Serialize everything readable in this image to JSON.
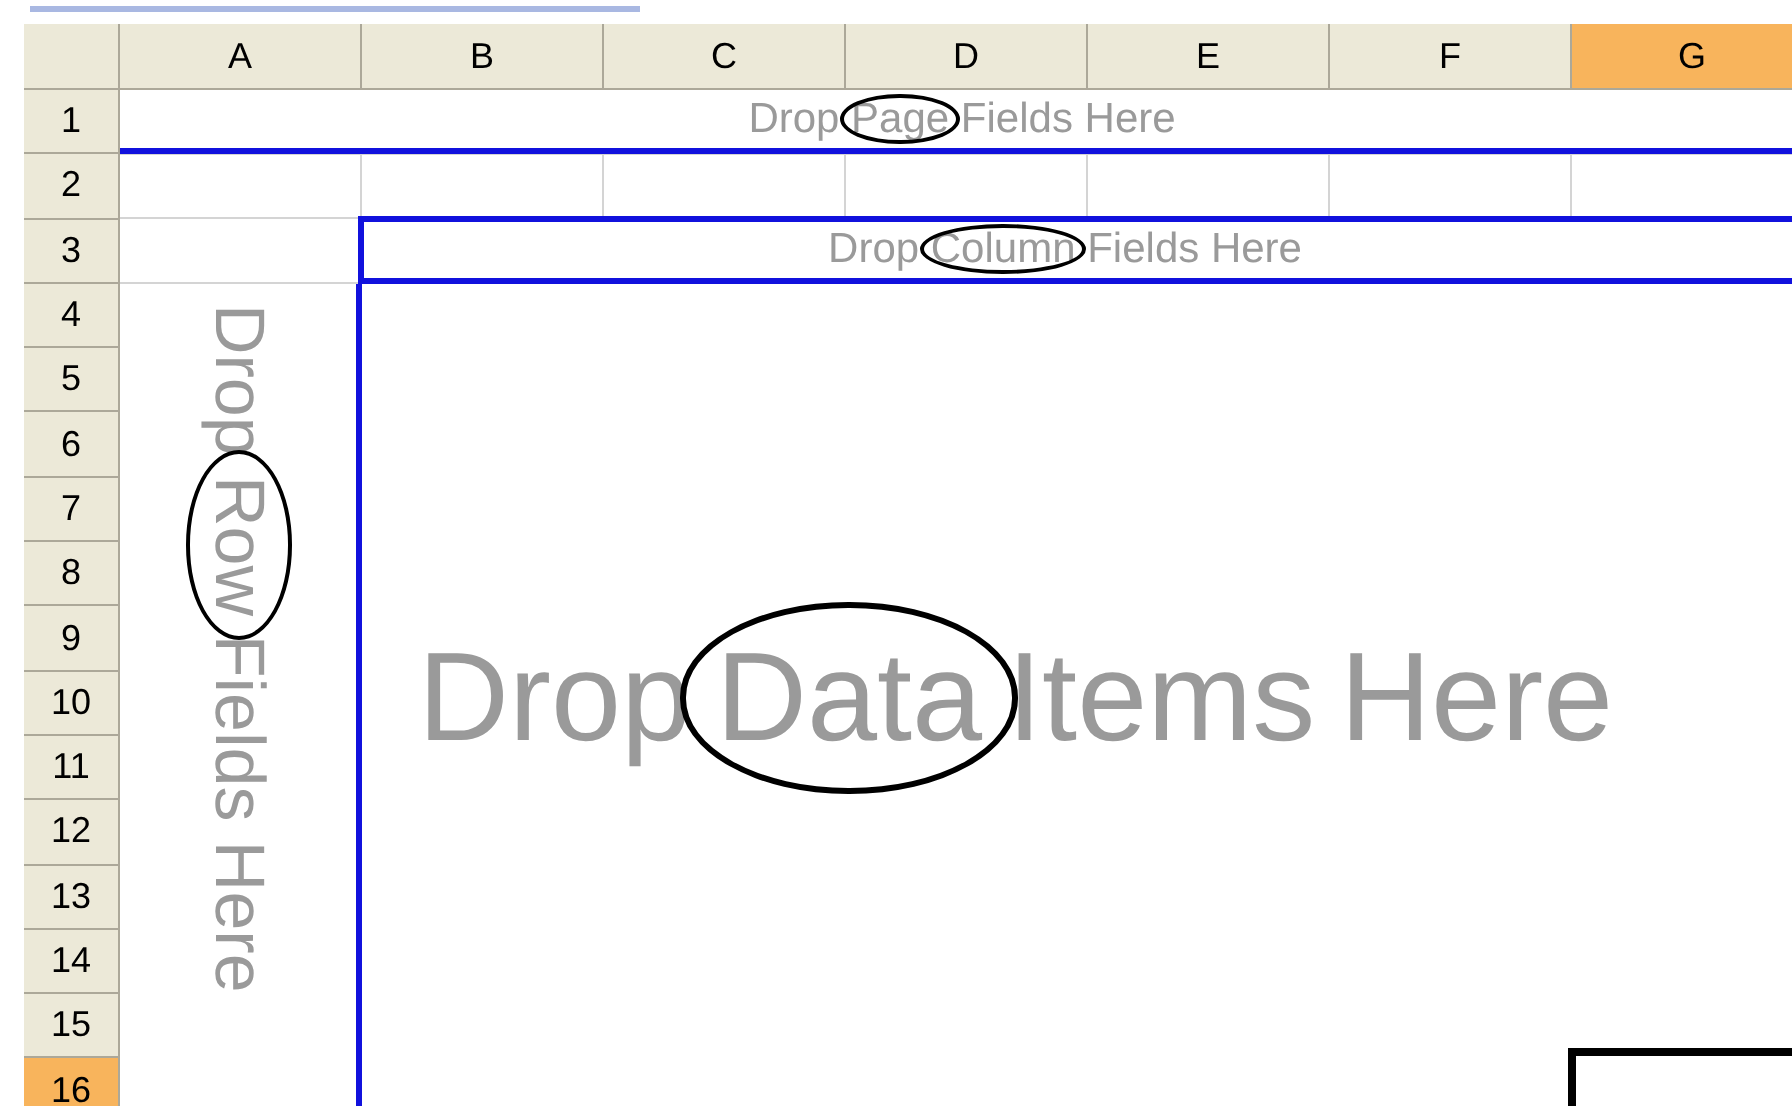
{
  "column_headers": [
    {
      "label": "A",
      "selected": false
    },
    {
      "label": "B",
      "selected": false
    },
    {
      "label": "C",
      "selected": false
    },
    {
      "label": "D",
      "selected": false
    },
    {
      "label": "E",
      "selected": false
    },
    {
      "label": "F",
      "selected": false
    },
    {
      "label": "G",
      "selected": true
    }
  ],
  "row_headers": [
    {
      "label": "1",
      "selected": false
    },
    {
      "label": "2",
      "selected": false
    },
    {
      "label": "3",
      "selected": false
    },
    {
      "label": "4",
      "selected": false
    },
    {
      "label": "5",
      "selected": false
    },
    {
      "label": "6",
      "selected": false
    },
    {
      "label": "7",
      "selected": false
    },
    {
      "label": "8",
      "selected": false
    },
    {
      "label": "9",
      "selected": false
    },
    {
      "label": "10",
      "selected": false
    },
    {
      "label": "11",
      "selected": false
    },
    {
      "label": "12",
      "selected": false
    },
    {
      "label": "13",
      "selected": false
    },
    {
      "label": "14",
      "selected": false
    },
    {
      "label": "15",
      "selected": false
    },
    {
      "label": "16",
      "selected": true
    }
  ],
  "drop_zones": [
    {
      "kind": "page",
      "before": "Drop",
      "circled": "Page",
      "after": "Fields Here"
    },
    {
      "kind": "column",
      "before": "Drop",
      "circled": "Column",
      "after": "Fields Here"
    },
    {
      "kind": "row",
      "before": "Drop",
      "circled": "Row",
      "after": "Fields Here"
    },
    {
      "kind": "data",
      "before": "Drop",
      "circled": "Data",
      "after": "Items Here"
    }
  ]
}
